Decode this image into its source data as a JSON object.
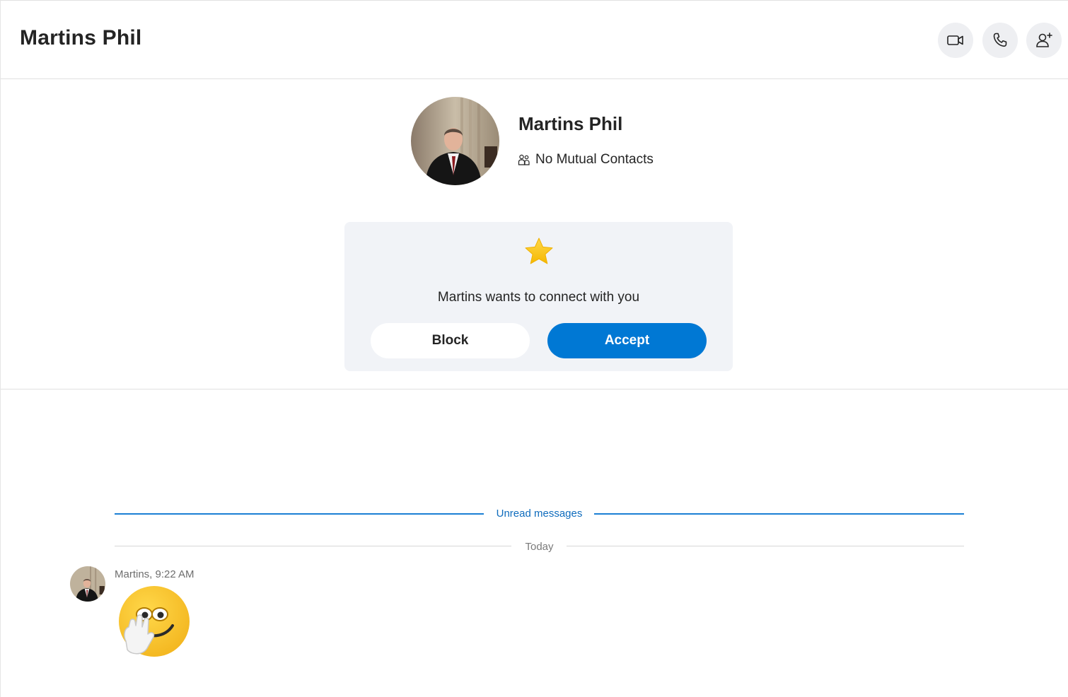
{
  "header": {
    "title": "Martins Phil",
    "buttons": [
      {
        "icon": "video-call-icon"
      },
      {
        "icon": "phone-icon"
      },
      {
        "icon": "add-person-icon"
      }
    ]
  },
  "profile": {
    "name": "Martins Phil",
    "mutual_contacts": "No Mutual Contacts"
  },
  "request": {
    "icon": "star-icon",
    "message": "Martins wants to connect with you",
    "block_label": "Block",
    "accept_label": "Accept"
  },
  "conversation": {
    "unread_label": "Unread messages",
    "date_label": "Today",
    "messages": [
      {
        "sender_time": "Martins, 9:22 AM",
        "content_icon": "hand-over-mouth-emoji-icon"
      }
    ]
  },
  "colors": {
    "accent": "#0078d4",
    "card_bg": "#f1f3f7",
    "icon_button_bg": "#eeeff2",
    "unread_line": "#1b7fd4"
  }
}
